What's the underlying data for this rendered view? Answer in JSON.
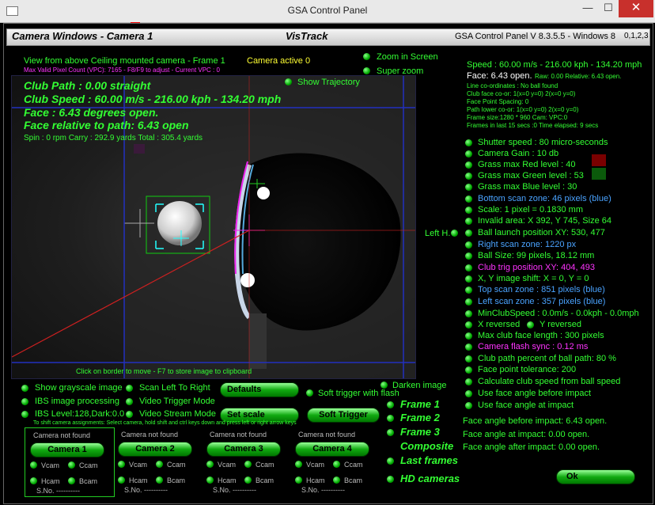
{
  "window": {
    "title": "GSA Control Panel",
    "minimize": "—",
    "maximize": "☐",
    "close": "✕"
  },
  "header": {
    "left": "Camera Windows - Camera  1",
    "middle": "VisTrack",
    "right": "GSA Control Panel V 8.3.5.5 - Windows 8",
    "cams": "0,1,2,3"
  },
  "camera_view": {
    "title": "View from above Ceiling mounted camera - Frame 1",
    "status": "Camera active 0",
    "vpc": "Max Valid Pixel Count (VPC): 7165  - F8/F9 to adjust - Current VPC : 0",
    "club_path": "Club Path : 0.00 straight",
    "club_speed": "Club Speed : 60.00 m/s - 216.00 kph - 134.20 mph",
    "face": "Face : 6.43 degrees open.",
    "face_rel": "Face relative to path: 6.43 open",
    "spin": "Spin : 0 rpm   Carry : 292.9 yards   Total : 305.4 yards",
    "show_trajectory": "Show Trajectory",
    "footer": "Click on border to move - F7 to store image to clipboard",
    "left_h": "Left H."
  },
  "zoom": {
    "zoom_in_screen": "Zoom in Screen",
    "super_zoom": "Super zoom"
  },
  "readout": {
    "speed": "Speed : 60.00 m/s - 216.00 kph - 134.20 mph",
    "face": "Face: 6.43 open.",
    "raw": "Raw: 0.00 Relative: 6.43 open.",
    "lines": [
      "Line co-ordinates : No ball found",
      "Club face co-or: 1(x=0 y=0) 2(x=0 y=0)",
      "Face Point Spacing: 0",
      "Path lower co-or: 1(x=0 y=0) 2(x=0 y=0)",
      "Frame size:1280 * 960 Cam:  VPC:0",
      "Frames in last 15 secs :0 Time elapsed:   9 secs"
    ]
  },
  "settings": [
    {
      "label": "Shutter speed : 80 micro-seconds",
      "color": "#33ff33"
    },
    {
      "label": "Camera Gain : 10 db",
      "color": "#33ff33"
    },
    {
      "label": "Grass max Red level : 40",
      "color": "#33ff33"
    },
    {
      "label": "Grass max Green level : 53",
      "color": "#33ff33"
    },
    {
      "label": "Grass max Blue level : 30",
      "color": "#33ff33"
    },
    {
      "label": "Bottom scan zone: 46 pixels (blue)",
      "color": "#4aa3ff"
    },
    {
      "label": "Scale: 1 pixel = 0.1830 mm",
      "color": "#33ff33"
    },
    {
      "label": "Invalid area: X 392, Y 745, Size 64",
      "color": "#33ff33"
    },
    {
      "label": "Ball launch position XY: 530, 477",
      "color": "#33ff33"
    },
    {
      "label": "Right scan zone: 1220 px",
      "color": "#4aa3ff"
    },
    {
      "label": "Ball Size: 99 pixels, 18.12 mm",
      "color": "#33ff33"
    },
    {
      "label": "Club trig position XY: 404, 493",
      "color": "#ff33ff"
    },
    {
      "label": "X, Y image shift: X = 0, Y = 0",
      "color": "#33ff33"
    },
    {
      "label": "Top scan zone : 851 pixels (blue)",
      "color": "#4aa3ff"
    },
    {
      "label": "Left scan zone : 357 pixels (blue)",
      "color": "#4aa3ff"
    },
    {
      "label": "MinClubSpeed : 0.0m/s - 0.0kph - 0.0mph",
      "color": "#33ff33"
    },
    {
      "label": "X reversed",
      "color": "#33ff33"
    },
    {
      "label": "Max club face length : 300 pixels",
      "color": "#33ff33"
    },
    {
      "label": "Camera flash sync : 0.12 ms",
      "color": "#ff33ff"
    },
    {
      "label": "Club path percent of ball path: 80 %",
      "color": "#33ff33"
    },
    {
      "label": "Face point tolerance: 200",
      "color": "#33ff33"
    },
    {
      "label": "Calculate club speed from ball speed",
      "color": "#33ff33"
    },
    {
      "label": "Use face angle before impact",
      "color": "#33ff33"
    },
    {
      "label": "Use face angle at impact",
      "color": "#33ff33"
    }
  ],
  "y_reversed": "Y reversed",
  "face_angles": {
    "before": "Face angle before impact: 6.43 open.",
    "at": "Face angle at impact:        0.00 open.",
    "after": "Face angle after impact:  0.00 open."
  },
  "ok": "Ok",
  "options": {
    "grayscale": "Show grayscale image",
    "scan_lr": "Scan Left To Right",
    "ibs": "IBS image processing",
    "video_trigger": "Video Trigger Mode",
    "ibs_level": "IBS Level:128,Dark:0.0",
    "video_stream": "Video Stream Mode",
    "defaults": "Defaults",
    "set_scale": "Set scale",
    "soft_trigger_flash": "Soft trigger with flash",
    "soft_trigger": "Soft Trigger",
    "darken": "Darken image",
    "assign_hint": "To shift camera assignments: Select camera, hold shift and ctrl keys down and press left or right arrow keys"
  },
  "frames": [
    "Frame 1",
    "Frame 2",
    "Frame 3",
    "Composite",
    "Last frames",
    "HD cameras"
  ],
  "cameras": [
    {
      "status": "Camera not found",
      "btn": "Camera 1",
      "vcam": "Vcam",
      "ccam": "Ccam",
      "hcam": "Hcam",
      "bcam": "Bcam",
      "sno": "S.No. ----------"
    },
    {
      "status": "Camera not found",
      "btn": "Camera 2",
      "vcam": "Vcam",
      "ccam": "Ccam",
      "hcam": "Hcam",
      "bcam": "Bcam",
      "sno": "S.No. ----------"
    },
    {
      "status": "Camera not found",
      "btn": "Camera 3",
      "vcam": "Vcam",
      "ccam": "Ccam",
      "hcam": "Hcam",
      "bcam": "Bcam",
      "sno": "S.No. ----------"
    },
    {
      "status": "Camera not found",
      "btn": "Camera 4",
      "vcam": "Vcam",
      "ccam": "Ccam",
      "hcam": "Hcam",
      "bcam": "Bcam",
      "sno": "S.No. ----------"
    }
  ]
}
